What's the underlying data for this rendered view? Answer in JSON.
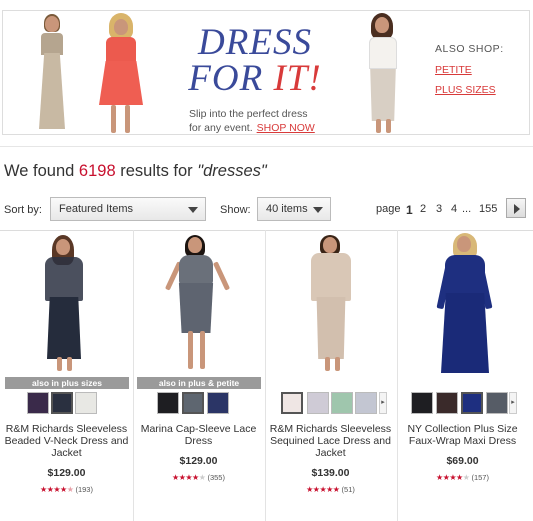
{
  "banner": {
    "title_line1": "DRESS",
    "title_line2_pre": "FOR ",
    "title_line2_it": "IT!",
    "subtitle_line1": "Slip into the perfect dress",
    "subtitle_line2": "for any event.",
    "shop_now": "SHOP NOW",
    "also_shop": "ALSO SHOP:",
    "link_petite": "PETITE",
    "link_plus": "PLUS SIZES"
  },
  "results": {
    "prefix": "We found ",
    "count": "6198",
    "middle": " results for ",
    "term": "\"dresses\""
  },
  "toolbar": {
    "sort_label": "Sort by:",
    "sort_value": "Featured Items",
    "show_label": "Show:",
    "show_value": "40 items",
    "page_label": "page",
    "pages": [
      "1",
      "2",
      "3",
      "4"
    ],
    "ellipsis": "...",
    "last_page": "155"
  },
  "products": [
    {
      "badge": "also in plus sizes",
      "name": "R&M Richards Sleeveless Beaded V-Neck Dress and Jacket",
      "price": "$129.00",
      "rating": 4.5,
      "reviews": "(193)",
      "swatches": [
        "#3a2a4a",
        "#2a3040",
        "#e8e8e4"
      ],
      "selected": 1
    },
    {
      "badge": "also in plus & petite",
      "name": "Marina Cap-Sleeve Lace Dress",
      "price": "$129.00",
      "rating": 4.0,
      "reviews": "(355)",
      "swatches": [
        "#1e1e22",
        "#5e6670",
        "#2b3566"
      ],
      "selected": 1
    },
    {
      "badge": "",
      "name": "R&M Richards Sleeveless Sequined Lace Dress and Jacket",
      "price": "$139.00",
      "rating": 5.0,
      "reviews": "(51)",
      "swatches": [
        "#efe6e4",
        "#cfcbd6",
        "#9fc6ad",
        "#c3c6d2"
      ],
      "selected": 0
    },
    {
      "badge": "",
      "name": "NY Collection Plus Size Faux-Wrap Maxi Dress",
      "price": "$69.00",
      "rating": 4.0,
      "reviews": "(157)",
      "swatches": [
        "#1e1e22",
        "#3a2a2a",
        "#1e2f80",
        "#565c66"
      ],
      "selected": 2
    }
  ],
  "colors": {
    "accent_red": "#c8102e",
    "banner_blue": "#3a4a9a"
  }
}
